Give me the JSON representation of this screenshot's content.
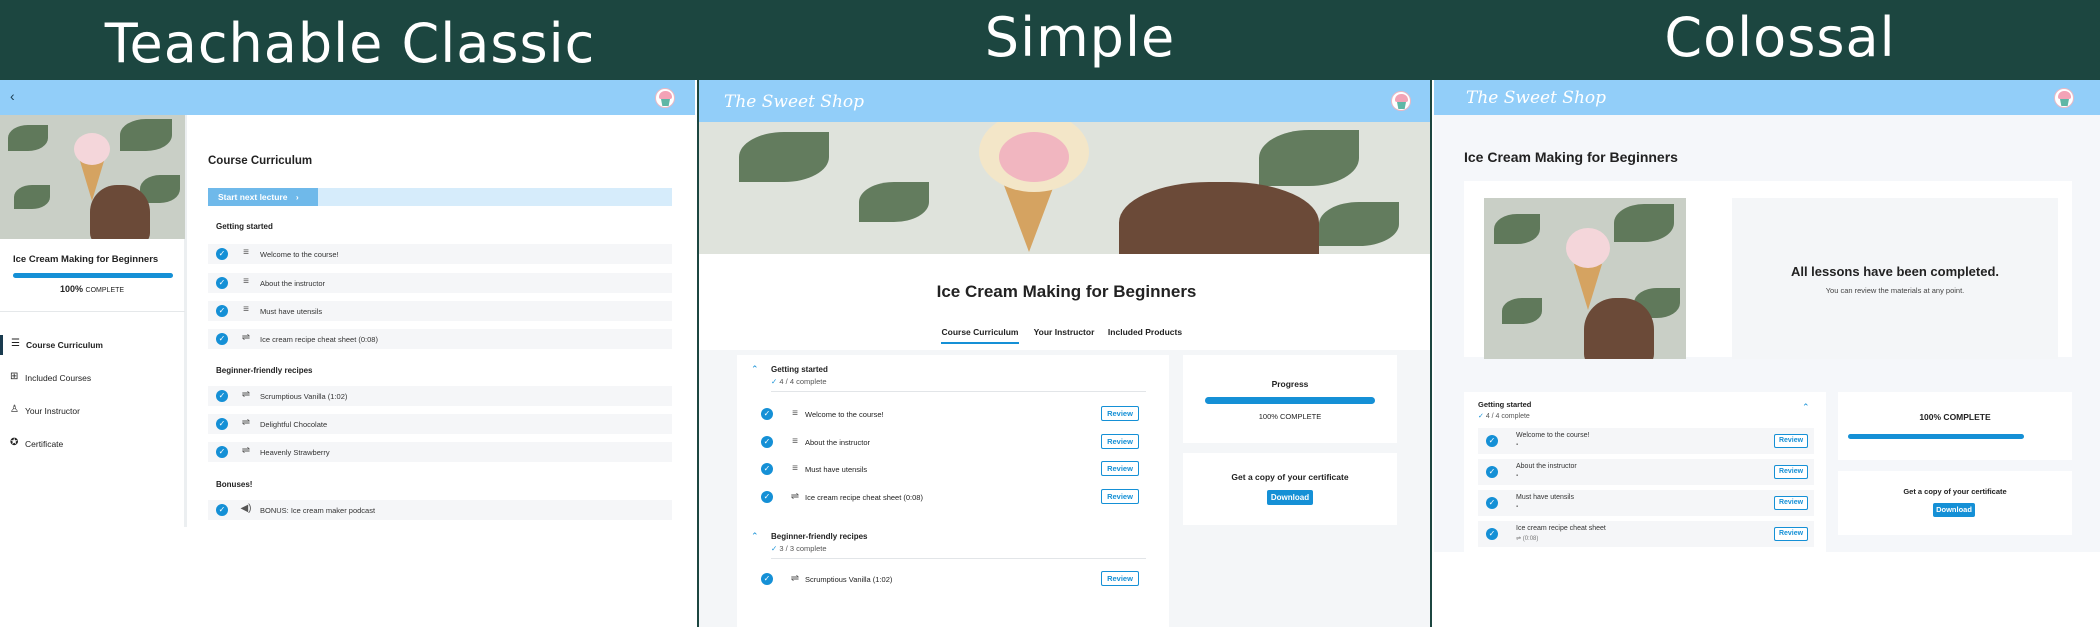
{
  "panel_titles": [
    "Teachable Classic",
    "Simple",
    "Colossal"
  ],
  "course_title": "Ice Cream Making for Beginners",
  "brand_name": "The Sweet Shop",
  "colors": {
    "banner": "#1c4640",
    "topbar": "#92cef9",
    "accent": "#1590d6"
  },
  "classic": {
    "back_icon": "chevron-left-icon",
    "percent": "100%",
    "complete_word": "COMPLETE",
    "progress": 1.0,
    "nav": [
      {
        "label": "Course Curriculum",
        "icon": "list-icon"
      },
      {
        "label": "Included Courses",
        "icon": "grid-icon"
      },
      {
        "label": "Your Instructor",
        "icon": "person-icon"
      },
      {
        "label": "Certificate",
        "icon": "badge-icon"
      }
    ],
    "curriculum_heading": "Course Curriculum",
    "start_next": "Start next lecture",
    "sections": [
      {
        "title": "Getting started",
        "lectures": [
          "Welcome to the course!",
          "About the instructor",
          "Must have utensils",
          "Ice cream recipe cheat sheet (0:08)"
        ]
      },
      {
        "title": "Beginner-friendly recipes",
        "lectures": [
          "Scrumptious Vanilla (1:02)",
          "Delightful Chocolate",
          "Heavenly Strawberry"
        ]
      },
      {
        "title": "Bonuses!",
        "lectures": [
          "BONUS: Ice cream maker podcast"
        ]
      }
    ]
  },
  "simple": {
    "tabs": [
      "Course Curriculum",
      "Your Instructor",
      "Included Products"
    ],
    "sections": [
      {
        "title": "Getting started",
        "count": "4 / 4 complete",
        "lectures": [
          "Welcome to the course!",
          "About the instructor",
          "Must have utensils",
          "Ice cream recipe cheat sheet (0:08)"
        ]
      },
      {
        "title": "Beginner-friendly recipes",
        "count": "3 / 3 complete",
        "lectures": [
          "Scrumptious Vanilla (1:02)"
        ]
      }
    ],
    "review_label": "Review",
    "progress_heading": "Progress",
    "progress_text": "100% COMPLETE",
    "progress": 1.0,
    "certificate_heading": "Get a copy of your certificate",
    "download_label": "Download"
  },
  "colossal": {
    "completed_heading": "All lessons have been completed.",
    "completed_sub": "You can review the materials at any point.",
    "section_title": "Getting started",
    "section_count": "4 / 4 complete",
    "lectures": [
      "Welcome to the course!",
      "About the instructor",
      "Must have utensils",
      "Ice cream recipe cheat sheet"
    ],
    "lecture_meta": [
      "",
      "",
      "",
      "(0:08)"
    ],
    "review_label": "Review",
    "progress_text": "100% COMPLETE",
    "progress": 1.0,
    "certificate_heading": "Get a copy of your certificate",
    "download_label": "Download"
  }
}
